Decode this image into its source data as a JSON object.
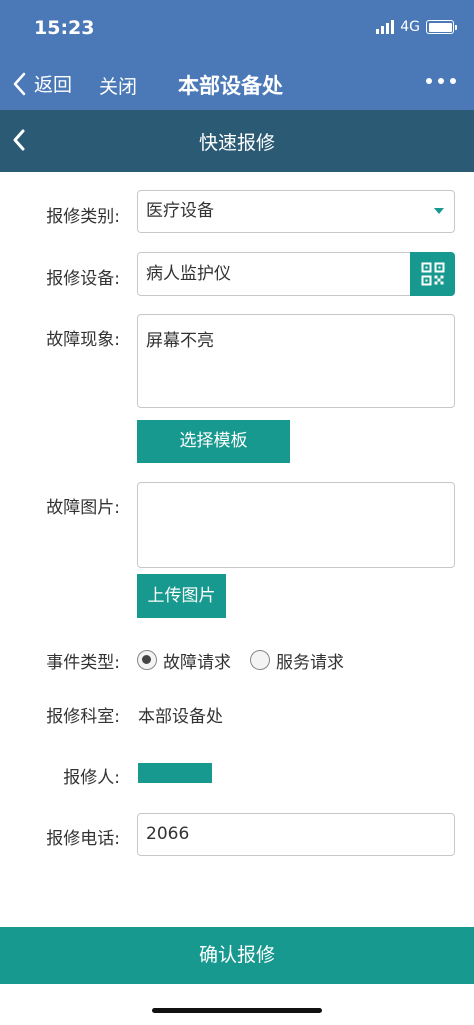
{
  "status": {
    "time": "15:23",
    "network": "4G"
  },
  "nav": {
    "back_label": "返回",
    "close_label": "关闭",
    "title": "本部设备处"
  },
  "page": {
    "title": "快速报修"
  },
  "form": {
    "category_label": "报修类别:",
    "category_value": "医疗设备",
    "device_label": "报修设备:",
    "device_value": "病人监护仪",
    "fault_label": "故障现象:",
    "fault_value": "屏幕不亮",
    "template_button": "选择模板",
    "image_label": "故障图片:",
    "upload_button": "上传图片",
    "event_type_label": "事件类型:",
    "event_options": [
      "故障请求",
      "服务请求"
    ],
    "event_selected": "故障请求",
    "dept_label": "报修科室:",
    "dept_value": "本部设备处",
    "reporter_label": "报修人:",
    "phone_label": "报修电话:",
    "phone_value": "2066"
  },
  "footer": {
    "confirm_button": "确认报修"
  },
  "colors": {
    "nav_blue": "#4b79b8",
    "sub_header": "#2b5b74",
    "teal": "#17998f"
  },
  "icons": [
    "back-chevron-icon",
    "more-dots-icon",
    "qr-code-icon",
    "dropdown-arrow-icon"
  ]
}
